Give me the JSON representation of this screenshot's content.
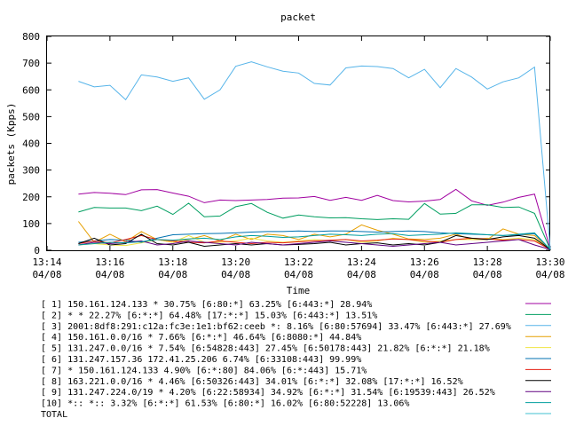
{
  "chart_data": {
    "type": "line",
    "title": "packet",
    "xlabel": "Time",
    "ylabel": "packets (Kpps)",
    "ylim": [
      0,
      800
    ],
    "yticks": [
      "0",
      "100",
      "200",
      "300",
      "400",
      "500",
      "600",
      "700",
      "800"
    ],
    "xticks": [
      {
        "time": "13:14",
        "date": "04/08"
      },
      {
        "time": "13:16",
        "date": "04/08"
      },
      {
        "time": "13:18",
        "date": "04/08"
      },
      {
        "time": "13:20",
        "date": "04/08"
      },
      {
        "time": "13:22",
        "date": "04/08"
      },
      {
        "time": "13:24",
        "date": "04/08"
      },
      {
        "time": "13:26",
        "date": "04/08"
      },
      {
        "time": "13:28",
        "date": "04/08"
      },
      {
        "time": "13:30",
        "date": "04/08"
      }
    ],
    "x": [
      "13:15",
      "13:15:30",
      "13:16",
      "13:16:30",
      "13:17",
      "13:17:30",
      "13:18",
      "13:18:30",
      "13:19",
      "13:19:30",
      "13:20",
      "13:20:30",
      "13:21",
      "13:21:30",
      "13:22",
      "13:22:30",
      "13:23",
      "13:23:30",
      "13:24",
      "13:24:30",
      "13:25",
      "13:25:30",
      "13:26",
      "13:26:30",
      "13:27",
      "13:27:30",
      "13:28",
      "13:28:30",
      "13:29",
      "13:29:30",
      "13:30"
    ],
    "grid": false,
    "legend_placement": "below",
    "series": [
      {
        "name": "[ 1] 150.161.124.133 * 30.75%  [6:80:*] 63.25% [6:443:*] 28.94%",
        "color": "#a000a0",
        "values": [
          210,
          216,
          213,
          208,
          226,
          227,
          214,
          202,
          178,
          188,
          186,
          188,
          190,
          195,
          196,
          201,
          187,
          198,
          187,
          205,
          186,
          181,
          184,
          190,
          228,
          185,
          168,
          180,
          198,
          210,
          5
        ]
      },
      {
        "name": "[ 2] * * 22.27%  [6:*:*] 64.48% [17:*:*] 15.03% [6:443:*] 13.51%",
        "color": "#009e60",
        "values": [
          143,
          160,
          158,
          158,
          148,
          165,
          134,
          176,
          125,
          128,
          163,
          175,
          142,
          120,
          132,
          125,
          121,
          122,
          118,
          115,
          118,
          116,
          175,
          135,
          138,
          170,
          170,
          160,
          162,
          138,
          3
        ]
      },
      {
        "name": "[ 3] 2001:8df8:291:c12a:fc3e:1e1:bf62:ceeb *: 8.16%  [6:80:57694] 33.47% [6:443:*] 27.69%",
        "color": "#56b4e9",
        "values": [
          632,
          611,
          617,
          563,
          656,
          648,
          632,
          645,
          565,
          600,
          688,
          705,
          686,
          670,
          663,
          624,
          618,
          682,
          689,
          687,
          680,
          645,
          677,
          608,
          680,
          648,
          603,
          630,
          645,
          685,
          5
        ]
      },
      {
        "name": "[ 4] 150.161.0.0/16 * 7.66%  [6:*:*] 46.64% [6:8080:*] 44.84%",
        "color": "#e69f00",
        "values": [
          108,
          30,
          60,
          32,
          70,
          40,
          30,
          40,
          55,
          35,
          60,
          40,
          60,
          55,
          40,
          60,
          50,
          60,
          95,
          75,
          60,
          42,
          40,
          45,
          60,
          40,
          40,
          80,
          60,
          55,
          3
        ]
      },
      {
        "name": "[ 5] 131.247.0.0/16 * 7.54%  [6:54828:443] 27.45% [6:50178:443] 21.82% [6:*:*] 21.18%",
        "color": "#f0e442",
        "values": [
          20,
          25,
          20,
          18,
          28,
          40,
          30,
          55,
          30,
          30,
          35,
          45,
          35,
          30,
          35,
          40,
          35,
          40,
          30,
          35,
          45,
          40,
          30,
          35,
          40,
          40,
          45,
          40,
          45,
          40,
          3
        ]
      },
      {
        "name": "[ 6] 131.247.157.36 172.41.25.206 6.74%  [6:33108:443] 99.99%",
        "color": "#0072b2",
        "values": [
          30,
          35,
          40,
          38,
          30,
          45,
          58,
          60,
          62,
          63,
          65,
          68,
          70,
          70,
          72,
          70,
          72,
          72,
          70,
          68,
          70,
          72,
          70,
          65,
          62,
          60,
          58,
          55,
          58,
          62,
          3
        ]
      },
      {
        "name": "[ 7] * 150.161.124.133 4.90%  [6:*:80] 84.06% [6:*:443] 15.71%",
        "color": "#e51e10",
        "values": [
          25,
          35,
          28,
          40,
          55,
          40,
          35,
          30,
          28,
          35,
          30,
          25,
          30,
          28,
          32,
          35,
          38,
          40,
          35,
          38,
          42,
          40,
          35,
          30,
          40,
          45,
          42,
          38,
          40,
          35,
          3
        ]
      },
      {
        "name": "[ 8] 163.221.0.0/16 * 4.46%  [6:50326:443] 34.01% [6:*:*] 32.08% [17:*:*] 16.52%",
        "color": "#000000",
        "values": [
          25,
          45,
          20,
          25,
          60,
          25,
          20,
          30,
          15,
          20,
          25,
          20,
          25,
          20,
          22,
          25,
          30,
          20,
          25,
          28,
          20,
          25,
          20,
          30,
          55,
          45,
          40,
          50,
          55,
          45,
          3
        ]
      },
      {
        "name": "[ 9] 131.247.224.0/19 * 4.20%  [6:22:58934] 34.92% [6:*:*] 31.54% [6:19539:443] 26.52%",
        "color": "#600080",
        "values": [
          20,
          30,
          25,
          30,
          35,
          20,
          25,
          35,
          30,
          25,
          20,
          30,
          25,
          20,
          25,
          30,
          35,
          30,
          25,
          20,
          15,
          20,
          25,
          30,
          20,
          25,
          30,
          35,
          40,
          20,
          3
        ]
      },
      {
        "name": "[10] *:: *:: 3.32%  [6:*:*] 61.53% [6:80:*] 16.02% [6:80:52228] 13.06%",
        "color": "#009e9e",
        "values": [
          20,
          25,
          30,
          28,
          32,
          40,
          38,
          42,
          45,
          40,
          50,
          55,
          52,
          48,
          50,
          55,
          60,
          58,
          55,
          60,
          62,
          55,
          58,
          60,
          65,
          62,
          58,
          55,
          60,
          65,
          3
        ]
      },
      {
        "name": "TOTAL",
        "color": "#40c0d0",
        "values": [
          null,
          null,
          null,
          null,
          null,
          null,
          null,
          null,
          null,
          null,
          null,
          null,
          null,
          null,
          null,
          null,
          null,
          null,
          null,
          null,
          null,
          null,
          null,
          null,
          null,
          null,
          null,
          null,
          null,
          null,
          null
        ]
      }
    ]
  }
}
